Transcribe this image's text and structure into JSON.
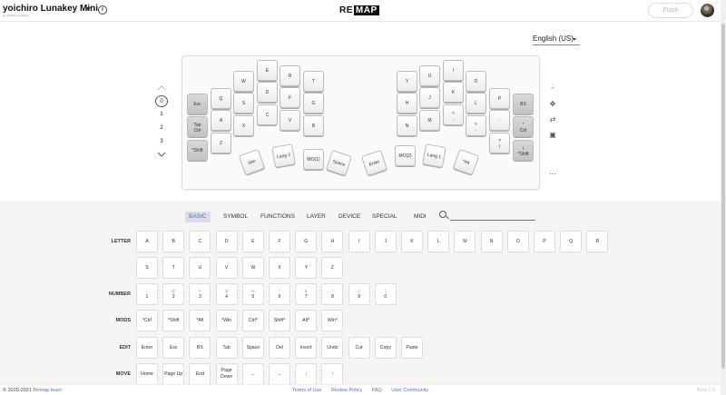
{
  "header": {
    "keyboard_name": "yoichiro Lunakey Mini",
    "keyboard_sub": "by yoichiro (Lunakey)",
    "logo_text": "RE",
    "logo_box": "MAP",
    "flash_label": "Flash"
  },
  "language": {
    "selected": "English (US)"
  },
  "layers": [
    "0",
    "1",
    "2",
    "3"
  ],
  "active_layer": "0",
  "keys_left": [
    "Esc",
    "Q",
    "W",
    "E",
    "R",
    "T",
    "Tab\nCtrl",
    "A",
    "S",
    "D",
    "F",
    "G",
    "*Shift",
    "Z",
    "X",
    "C",
    "V",
    "B",
    "Win",
    "Lang 2",
    "MO(1)",
    "Space"
  ],
  "keys_right": [
    "Y",
    "U",
    "I",
    "O",
    "P",
    "BS",
    "H",
    "J",
    "K",
    "L",
    ":",
    "\"\nCtrl",
    "N",
    "M",
    "<\n,",
    ">\n.",
    "?\n/",
    "\\\n*Shift",
    "Enter",
    "MO(2)",
    "Lang 1",
    "*Alt"
  ],
  "categories": [
    {
      "label": "BASIC",
      "active": true
    },
    {
      "label": "SYMBOL",
      "active": false
    },
    {
      "label": "FUNCTIONS",
      "active": false
    },
    {
      "label": "LAYER",
      "active": false
    },
    {
      "label": "DEVICE",
      "active": false
    },
    {
      "label": "SPECIAL",
      "active": false
    },
    {
      "label": "MIDI",
      "active": false
    }
  ],
  "rows": {
    "letter": "LETTER",
    "number": "NUMBER",
    "mods": "MODS",
    "edit": "EDIT",
    "move": "MOVE"
  },
  "letter_keys_1": [
    "A",
    "B",
    "C",
    "D",
    "E",
    "F",
    "G",
    "H",
    "I",
    "J",
    "K",
    "L",
    "M",
    "N",
    "O",
    "P",
    "Q",
    "R"
  ],
  "letter_keys_2": [
    "S",
    "T",
    "U",
    "V",
    "W",
    "X",
    "Y",
    "Z"
  ],
  "number_keys": [
    {
      "sub": "!",
      "main": "1"
    },
    {
      "sub": "@",
      "main": "2"
    },
    {
      "sub": "#",
      "main": "3"
    },
    {
      "sub": "$",
      "main": "4"
    },
    {
      "sub": "%",
      "main": "5"
    },
    {
      "sub": "^",
      "main": "6"
    },
    {
      "sub": "&",
      "main": "7"
    },
    {
      "sub": "*",
      "main": "8"
    },
    {
      "sub": "(",
      "main": "9"
    },
    {
      "sub": ")",
      "main": "0"
    }
  ],
  "mods_keys": [
    "*Ctrl",
    "*Shift",
    "*Alt",
    "*Win",
    "Ctrl*",
    "Shift*",
    "Alt*",
    "Win*"
  ],
  "edit_keys": [
    "Enter",
    "Esc",
    "BS",
    "Tab",
    "Space",
    "Del",
    "Insert",
    "Undo",
    "Cut",
    "Copy",
    "Paste"
  ],
  "move_keys": [
    "Home",
    "Page Up",
    "End",
    "Page Down",
    "→",
    "←",
    "↓",
    "↑"
  ],
  "footer": {
    "copyright": "© 2020-2021",
    "team": "Remap team",
    "links": [
      "Terms of Use",
      "Review Policy",
      "FAQ",
      "User Community"
    ],
    "version": "Beta 1.0"
  }
}
